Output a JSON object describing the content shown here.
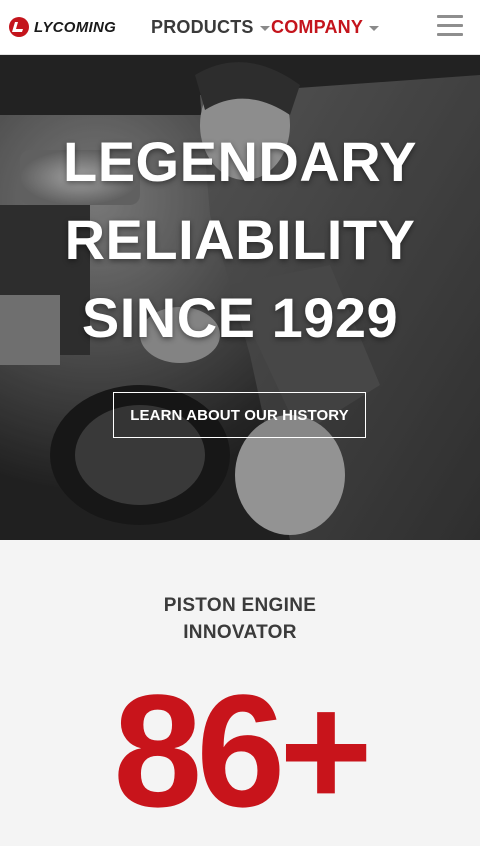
{
  "header": {
    "logo_text": "LYCOMING",
    "nav": [
      {
        "label": "PRODUCTS"
      },
      {
        "label": "COMPANY"
      }
    ],
    "menu_icon": "hamburger-menu-icon",
    "colors": {
      "active": "#c4141c",
      "inactive": "#3a3a3a"
    }
  },
  "hero": {
    "title_lines": [
      "LEGENDARY",
      "RELIABILITY",
      "SINCE 1929"
    ],
    "button_label": "LEARN ABOUT OUR HISTORY",
    "image": "black-and-white photo of mechanic working on engine"
  },
  "stat": {
    "heading_lines": [
      "PISTON ENGINE",
      "INNOVATOR"
    ],
    "number": "86+",
    "number_color": "#c8141b"
  }
}
